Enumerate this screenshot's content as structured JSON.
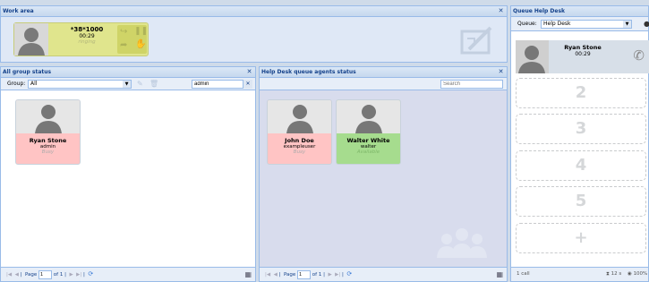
{
  "work_area": {
    "title": "Work area",
    "call": {
      "number": "*38*1000",
      "duration": "00:29",
      "status": "ringing"
    }
  },
  "group_status": {
    "title": "All group status",
    "group_label": "Group:",
    "group_value": "All",
    "search_value": "admin",
    "agents": [
      {
        "name": "Ryan Stone",
        "ext": "admin",
        "status": "Busy",
        "color": "#ffc4c4"
      }
    ],
    "pager": {
      "page_label": "Page",
      "page_value": "1",
      "of_label": "of 1"
    }
  },
  "queue_agents": {
    "title": "Help Desk queue agents status",
    "search_placeholder": "Search",
    "agents": [
      {
        "name": "John Doe",
        "ext": "exampleuser",
        "status": "Busy",
        "color": "#ffc4c4"
      },
      {
        "name": "Walter White",
        "ext": "walter",
        "status": "Available",
        "color": "#a6dc8e"
      }
    ],
    "pager": {
      "page_label": "Page",
      "page_value": "1",
      "of_label": "of 1"
    }
  },
  "queue_help": {
    "title": "Queue Help Desk",
    "queue_label": "Queue:",
    "queue_value": "Help Desk",
    "caller": {
      "name": "Ryan Stone",
      "duration": "00:29"
    },
    "slots": [
      "2",
      "3",
      "4",
      "5",
      "+"
    ],
    "footer": {
      "calls": "1 call",
      "wait": "12 s",
      "percent": "100%"
    }
  }
}
